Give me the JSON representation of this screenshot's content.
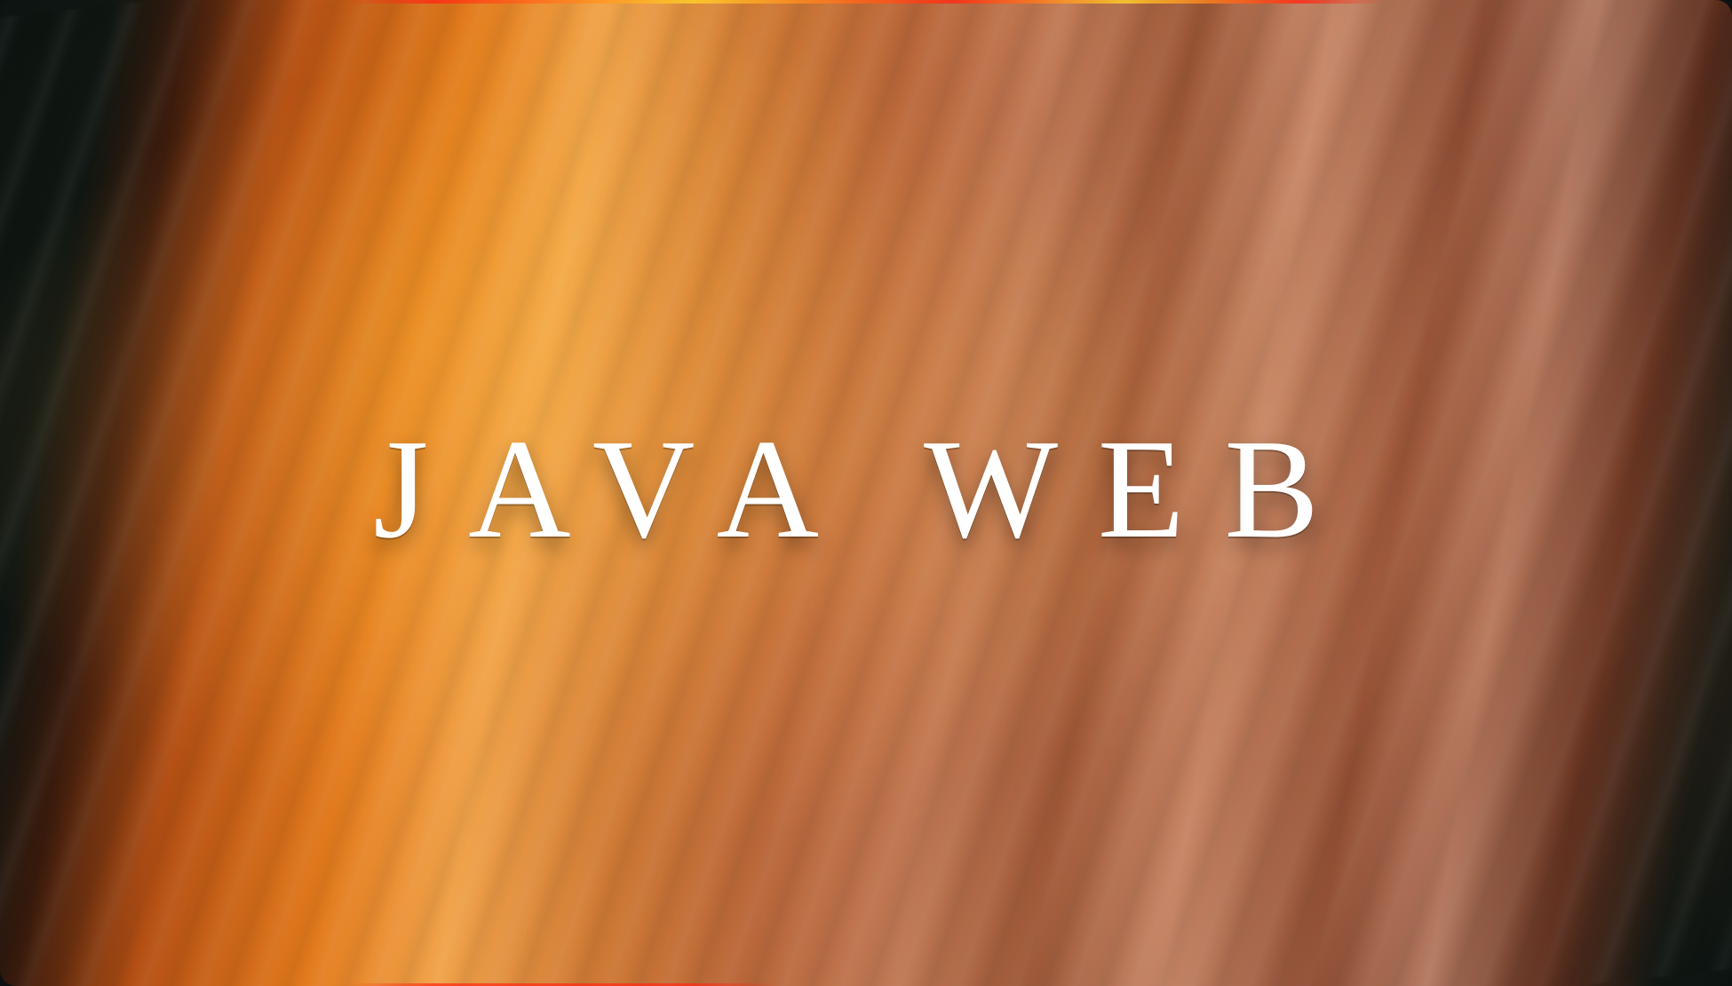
{
  "slide": {
    "title": "JAVA WEB"
  },
  "colors": {
    "background_dark": "#0c120f",
    "accent_orange": "#e27a1d",
    "text_white": "#ffffff",
    "strip_red": "#ff2814",
    "strip_yellow": "#ffd228"
  }
}
